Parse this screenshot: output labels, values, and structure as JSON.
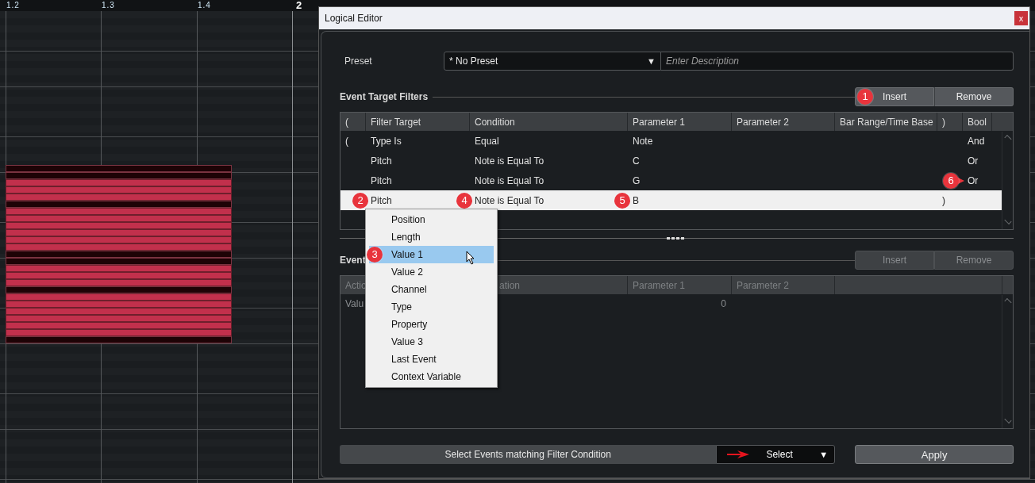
{
  "ruler": {
    "labels": [
      {
        "text": "1.2",
        "kind": "beat"
      },
      {
        "text": "1.3",
        "kind": "beat"
      },
      {
        "text": "1.4",
        "kind": "beat"
      },
      {
        "text": "2",
        "kind": "bar"
      }
    ]
  },
  "notes": [
    {
      "selected": false
    },
    {
      "selected": false
    },
    {
      "selected": true
    },
    {
      "selected": true
    },
    {
      "selected": true
    },
    {
      "selected": false
    },
    {
      "selected": true
    },
    {
      "selected": true
    },
    {
      "selected": true
    },
    {
      "selected": true
    },
    {
      "selected": true
    },
    {
      "selected": true
    },
    {
      "selected": false
    },
    {
      "selected": false
    },
    {
      "selected": true
    },
    {
      "selected": true
    },
    {
      "selected": true
    },
    {
      "selected": false
    },
    {
      "selected": true
    },
    {
      "selected": true
    },
    {
      "selected": true
    },
    {
      "selected": true
    },
    {
      "selected": true
    },
    {
      "selected": true
    },
    {
      "selected": false
    }
  ],
  "dialog": {
    "title": "Logical Editor",
    "close": "x",
    "preset": {
      "label": "Preset",
      "value": "* No Preset",
      "arrow": "▼",
      "description_placeholder": "Enter Description"
    },
    "filters": {
      "title": "Event Target Filters",
      "buttons": [
        {
          "label": "Insert",
          "disabled": false,
          "callout": "1"
        },
        {
          "label": "Remove",
          "disabled": false
        }
      ],
      "columns": [
        "(",
        "Filter Target",
        "Condition",
        "Parameter 1",
        "Parameter 2",
        "Bar Range/Time Base",
        ")",
        "Bool"
      ],
      "rows": [
        {
          "selected": false,
          "open_paren": "(",
          "filter_target": "Type Is",
          "condition": "Equal",
          "parameter_1": "Note",
          "bool": "And"
        },
        {
          "selected": false,
          "filter_target": "Pitch",
          "condition": "Note is Equal To",
          "parameter_1": "C",
          "bool": "Or"
        },
        {
          "selected": false,
          "filter_target": "Pitch",
          "condition": "Note is Equal To",
          "parameter_1": "G",
          "bool": "Or",
          "callouts": {
            "close_paren": {
              "label": "6",
              "kind": "arrow"
            }
          }
        },
        {
          "selected": true,
          "filter_target": "Pitch",
          "condition": "Note is Equal To",
          "parameter_1": "B",
          "close_paren": ")",
          "callouts": {
            "open_paren": {
              "label": "2",
              "kind": "plain"
            },
            "filter_target": {
              "label": "4",
              "kind": "plain"
            },
            "condition": {
              "label": "5",
              "kind": "plain"
            }
          }
        }
      ]
    },
    "actions": {
      "title": "Event",
      "buttons": [
        {
          "label": "Insert",
          "disabled": true
        },
        {
          "label": "Remove",
          "disabled": true
        }
      ],
      "columns": [
        "Actio",
        "ation",
        "Parameter 1",
        "Parameter 2"
      ],
      "rows": [
        {
          "action": "Valu",
          "parameter_1": "0"
        }
      ]
    },
    "menu": {
      "items": [
        {
          "label": "Position",
          "selected": false
        },
        {
          "label": "Length",
          "selected": false
        },
        {
          "label": "Value 1",
          "selected": true,
          "callout": "3"
        },
        {
          "label": "Value 2",
          "selected": false
        },
        {
          "label": "Channel",
          "selected": false
        },
        {
          "label": "Type",
          "selected": false
        },
        {
          "label": "Property",
          "selected": false
        },
        {
          "label": "Value 3",
          "selected": false
        },
        {
          "label": "Last Event",
          "selected": false
        },
        {
          "label": "Context Variable",
          "selected": false
        }
      ]
    },
    "footer": {
      "mode_label": "Select Events matching Filter Condition",
      "function": {
        "value": "Select",
        "arrow": "▼"
      },
      "apply": "Apply"
    }
  }
}
